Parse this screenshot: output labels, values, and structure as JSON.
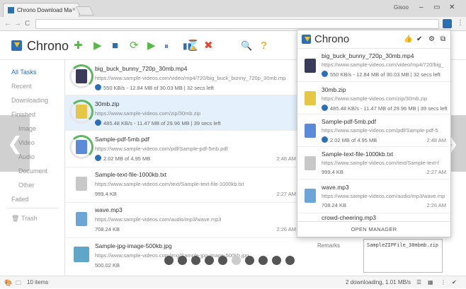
{
  "browser": {
    "tab_title": "Chrono Download Mana",
    "user": "Gisoo",
    "window_controls": [
      "–",
      "▭",
      "✕"
    ],
    "nav_back": "←",
    "nav_forward": "→",
    "nav_reload": "C",
    "menu_glyph": "⋮"
  },
  "app": {
    "name": "Chrono",
    "toolbar": [
      "add",
      "start",
      "stop",
      "refresh",
      "start-all",
      "pause-all",
      "library",
      "clear",
      "delete",
      "search",
      "help"
    ],
    "toolbar_glyphs": [
      "✚",
      "▶",
      "■",
      "⟳",
      "▶",
      "⏸",
      "▮▮",
      "⌛",
      "✖",
      "🔍",
      "?"
    ]
  },
  "sidebar": {
    "items": [
      {
        "label": "All Tasks",
        "active": true
      },
      {
        "label": "Recent"
      },
      {
        "label": "Downloading"
      },
      {
        "label": "Finished"
      },
      {
        "label": "Image"
      },
      {
        "label": "Video"
      },
      {
        "label": "Audio"
      },
      {
        "label": "Document"
      },
      {
        "label": "Other"
      },
      {
        "label": "Failed"
      }
    ],
    "trash": "Trash"
  },
  "downloads": [
    {
      "name": "big_buck_bunny_720p_30mb.mp4",
      "url": "https://www.sample-videos.com/video/mp4/720/big_buck_bunny_720p_30mb.mp4",
      "status": "550 KB/s - 12.84 MB of 30.03 MB | 32 secs left",
      "time": "",
      "icon": "video-file-icon",
      "color": "#3a3a5a"
    },
    {
      "name": "30mb.zip",
      "url": "https://www.sample-videos.com/zip/30mb.zip",
      "status": "485.48 KB/s - 11.47 MB of 29.96 MB | 39 secs left",
      "time": "",
      "icon": "zip-file-icon",
      "color": "#e6c645"
    },
    {
      "name": "Sample-pdf-5mb.pdf",
      "url": "https://www.sample-videos.com/pdf/Sample-pdf-5mb.pdf",
      "status": "2.02 MB of 4.95 MB",
      "time": "2:48 AM",
      "icon": "pdf-file-icon",
      "color": "#5b8bd8"
    },
    {
      "name": "Sample-text-file-1000kb.txt",
      "url": "https://www.sample-videos.com/text/Sample-text-file-1000kb.txt",
      "status": "999.4 KB",
      "time": "2:27 AM",
      "icon": "text-file-icon",
      "color": "#c8c8c8"
    },
    {
      "name": "wave.mp3",
      "url": "https://www.sample-videos.com/audio/mp3/wave.mp3",
      "status": "708.24 KB",
      "time": "2:26 AM",
      "icon": "audio-file-icon",
      "color": "#6ca6d9"
    },
    {
      "name": "Sample-jpg-image-500kb.jpg",
      "url": "https://www.sample-videos.com/img/Sample-jpg-image-500kb.jpg",
      "status": "500.02 KB",
      "time": "",
      "icon": "image-file-icon",
      "color": "#5fa6c9"
    }
  ],
  "details": {
    "remarks_label": "Remarks",
    "remarks_value": "SampleZIPFile_30mbmb.zip"
  },
  "statusbar": {
    "items_count": "10 items",
    "summary": "2 downloading, 1.01 MB/s"
  },
  "popup": {
    "title": "Chrono",
    "icons": [
      "thumb-up",
      "broom",
      "gear",
      "window"
    ],
    "items": [
      {
        "name": "big_buck_bunny_720p_30mb.mp4",
        "url": "https://www.sample-videos.com/video/mp4/720/big_",
        "status": "550 KB/s - 12.84 MB of 30.03 MB | 32 secs left",
        "time": "",
        "icon": "video-file-icon",
        "color": "#3a3a5a"
      },
      {
        "name": "30mb.zip",
        "url": "https://www.sample-videos.com/zip/30mb.zip",
        "status": "485.48 KB/s - 11.47 MB of 29.96 MB | 39 secs left",
        "time": "",
        "icon": "zip-file-icon",
        "color": "#e6c645"
      },
      {
        "name": "Sample-pdf-5mb.pdf",
        "url": "https://www.sample-videos.com/pdf/Sample-pdf-5",
        "status": "2.02 MB of 4.95 MB",
        "time": "2:48 AM",
        "icon": "pdf-file-icon",
        "color": "#5b8bd8"
      },
      {
        "name": "Sample-text-file-1000kb.txt",
        "url": "https://www.sample-videos.com/text/Sample-text-f",
        "status": "999.4 KB",
        "time": "2:27 AM",
        "icon": "text-file-icon",
        "color": "#c8c8c8"
      },
      {
        "name": "wave.mp3",
        "url": "https://www.sample-videos.com/audio/mp3/wave.mp3",
        "status": "708.24 KB",
        "time": "2:26 AM",
        "icon": "audio-file-icon",
        "color": "#6ca6d9"
      },
      {
        "name": "crowd-cheering.mp3",
        "url": "",
        "status": "",
        "time": "",
        "icon": "audio-file-icon",
        "color": "#6ca6d9"
      }
    ],
    "open_manager": "OPEN MANAGER"
  },
  "carousel": {
    "count": 10,
    "active_index": 5,
    "prev": "❮",
    "next": "❯"
  },
  "colors": {
    "accent": "#2b6fb5",
    "ring": "#5cb85c",
    "selected_row": "#e4f0fb"
  }
}
